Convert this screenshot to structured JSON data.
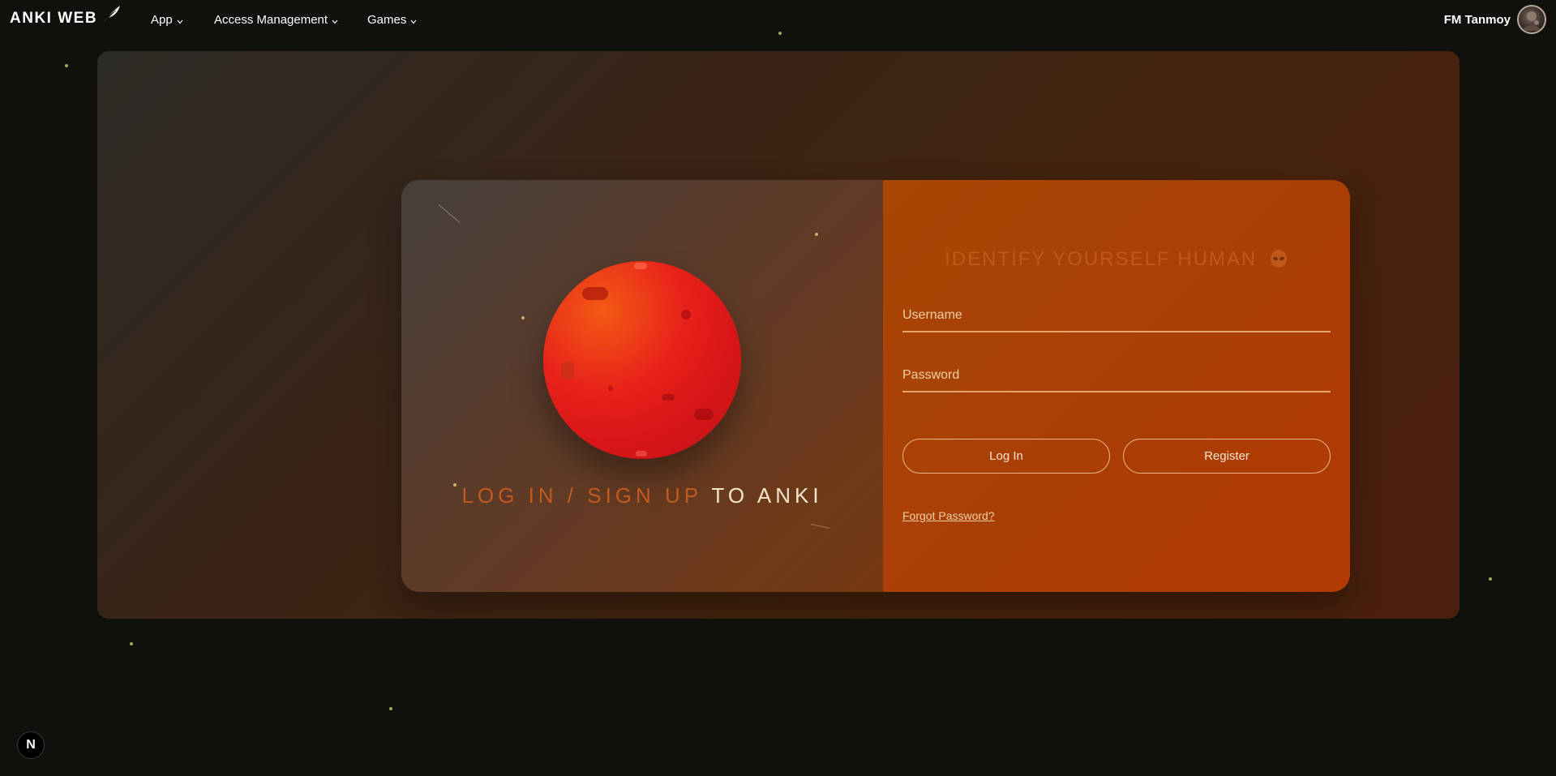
{
  "brand": {
    "name": "ANKI WEB",
    "logo_icon": "feather-icon"
  },
  "nav": {
    "items": [
      {
        "label": "App",
        "icon": "chevron-down-icon"
      },
      {
        "label": "Access Management",
        "icon": "chevron-down-icon"
      },
      {
        "label": "Games",
        "icon": "chevron-down-icon"
      }
    ]
  },
  "user": {
    "name": "FM Tanmoy",
    "avatar_icon": "avatar"
  },
  "left_panel": {
    "tagline_part1": "LOG IN / SIGN UP",
    "tagline_part2": "TO ANKI"
  },
  "login_form": {
    "heading": "IDENTIFY YOURSELF HUMAN",
    "heading_icon": "alien-icon",
    "username": {
      "placeholder": "Username",
      "value": ""
    },
    "password": {
      "placeholder": "Password",
      "value": ""
    },
    "login_label": "Log In",
    "register_label": "Register",
    "forgot_label": "Forgot Password?"
  },
  "dev_badge": {
    "label": "N"
  },
  "colors": {
    "page_bg": "#10110c",
    "card_left": "#5a3b2b",
    "card_right": "#aa3f05",
    "planet": "#e8221a",
    "accent_text": "#c25a1e",
    "star": "#b7c46a"
  }
}
